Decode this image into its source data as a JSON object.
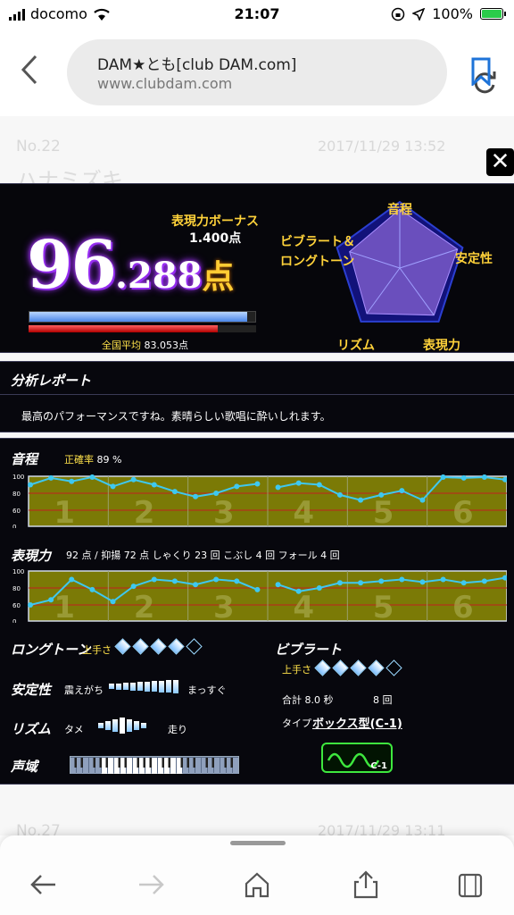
{
  "status": {
    "carrier": "docomo",
    "time": "21:07",
    "battery": "100%",
    "battery_level": 1.0
  },
  "browser": {
    "title": "DAM★とも[club DAM.com]",
    "host": "www.clubdam.com"
  },
  "background_page": {
    "entry1": {
      "no": "No.22",
      "date": "2017/11/29 13:52",
      "song": "ハナミズキ"
    },
    "entry2": {
      "no": "No.27",
      "date": "2017/11/29 13:11"
    }
  },
  "score": {
    "bonus_label": "表現力ボーナス",
    "bonus_value": "1.400点",
    "int_part": "96",
    "dec_part": ".288",
    "unit": "点",
    "avg_label": "全国平均",
    "avg_value": "83.053点",
    "score_fraction": 0.96288,
    "avg_fraction": 0.83053
  },
  "radar": {
    "labels": [
      "音程",
      "安定性",
      "表現力",
      "リズム",
      "ビブラート＆ロングトーン"
    ],
    "values": [
      0.89,
      0.92,
      0.88,
      0.85,
      0.8
    ]
  },
  "report": {
    "title": "分析レポート",
    "text": "最高のパフォーマンスですね。素晴らしい歌唱に酔いしれます。"
  },
  "pitch": {
    "title": "音程",
    "accuracy_label": "正確率",
    "accuracy_value": "89 %",
    "y_ticks": [
      "100",
      "80",
      "60",
      "0"
    ],
    "section_numbers": [
      "1",
      "2",
      "3",
      "4",
      "5",
      "6"
    ]
  },
  "expression": {
    "title": "表現力",
    "stats": "92 点 / 抑揚 72 点 しゃくり 23 回 こぶし 4 回 フォール 4 回",
    "y_ticks": [
      "100",
      "80",
      "60",
      "0"
    ]
  },
  "longtone": {
    "label": "ロングトーン",
    "skill_label": "上手さ",
    "level": 4,
    "max": 5
  },
  "stability": {
    "label": "安定性",
    "left": "震えがち",
    "right": "まっすぐ"
  },
  "rhythm": {
    "label": "リズム",
    "left": "タメ",
    "right": "走り"
  },
  "range": {
    "label": "声域"
  },
  "vibrato": {
    "label": "ビブラート",
    "skill_label": "上手さ",
    "level": 4,
    "max": 5,
    "total_label": "合計",
    "total_value": "8.0 秒",
    "count": "8 回",
    "type_label": "タイプ",
    "type_value": "ボックス型(C-1)",
    "type_badge": "C-1"
  },
  "chart_data": [
    {
      "type": "line",
      "title": "音程",
      "y_ticks": [
        "100",
        "80",
        "60",
        "0"
      ],
      "categories": [
        "1",
        "2",
        "3",
        "4",
        "5",
        "6"
      ],
      "values": [
        90,
        98,
        94,
        99,
        88,
        96,
        90,
        82,
        76,
        80,
        88,
        91,
        87,
        92,
        90,
        78,
        72,
        78,
        83,
        72,
        99,
        98,
        99,
        96
      ]
    },
    {
      "type": "line",
      "title": "表現力",
      "y_ticks": [
        "100",
        "80",
        "60",
        "0"
      ],
      "categories": [
        "1",
        "2",
        "3",
        "4",
        "5",
        "6"
      ],
      "values": [
        60,
        66,
        90,
        78,
        64,
        82,
        90,
        88,
        84,
        90,
        88,
        78,
        84,
        76,
        80,
        86,
        86,
        88,
        90,
        87,
        90,
        86,
        88,
        92
      ]
    }
  ],
  "colors": {
    "panel": "#07070d",
    "accent_yellow": "#ffd23a",
    "chart_fill": "#7b7a06",
    "line": "#3ec8f0"
  }
}
